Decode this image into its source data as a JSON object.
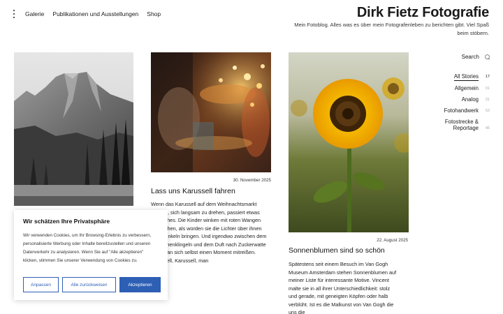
{
  "header": {
    "nav": [
      "Galerie",
      "Publikationen und Ausstellungen",
      "Shop"
    ],
    "title": "Dirk Fietz Fotografie",
    "tagline": "Mein Fotoblog. Alles was es über mein Fotografenleben zu berichten gibt. Viel Spaß beim stöbern."
  },
  "posts": [
    {
      "image": "mountain-landscape-bw",
      "date": "",
      "title": "",
      "excerpt": ""
    },
    {
      "image": "carousel-lights-blur",
      "date": "30. November 2025",
      "title": "Lass uns Karussell fahren",
      "excerpt": "Wenn das Karussell auf dem Weihnachtsmarkt beginnt, sich langsam zu drehen, passiert etwas Magisches. Die Kinder winken mit roten Wangen und lachen, als würden sie die Lichter über ihnen zum Funkeln bringen. Und irgendwo zwischen dem Glöckchenklingeln und dem Duft nach Zuckerwatte lässt man sich selbst einen Moment mitreißen. Karussell, Karussell, man"
    },
    {
      "image": "sunflower",
      "date": "22. August 2025",
      "title": "Sonnenblumen sind so schön",
      "excerpt": "Spätestens seit einem Besuch im Van Gogh Museum Amsterdam stehen Sonnenblumen auf meiner Liste für interessante Motive. Vincent malte sie in all ihrer Unterschiedlichkeit: stolz und gerade, mit geneigten Köpfen oder halb verblüht. Ist es die Malkunst von Van Gogh die uns die"
    }
  ],
  "sidebar": {
    "search_label": "Search",
    "categories": [
      {
        "label": "All Stories",
        "count": "17",
        "active": true
      },
      {
        "label": "Allgemein",
        "count": "01",
        "active": false
      },
      {
        "label": "Analog",
        "count": "31",
        "active": false
      },
      {
        "label": "Fotohandwerk",
        "count": "53",
        "active": false
      },
      {
        "label": "Fotostrecke & Reportage",
        "count": "46",
        "active": false
      }
    ]
  },
  "cookie": {
    "title": "Wir schätzen Ihre Privatsphäre",
    "text": "Wir verwenden Cookies, um Ihr Browsing-Erlebnis zu verbessern, personalisierte Werbung oder Inhalte bereitzustellen und unseren Datenverkehr zu analysieren. Wenn Sie auf \"Alle akzeptieren\" klicken, stimmen Sie unserer Verwendung von Cookies zu.",
    "customize": "Anpassen",
    "reject": "Alle zurückweisen",
    "accept": "Akzeptieren"
  },
  "colors": {
    "accent": "#2d5fb5",
    "text": "#1a1a1a"
  }
}
